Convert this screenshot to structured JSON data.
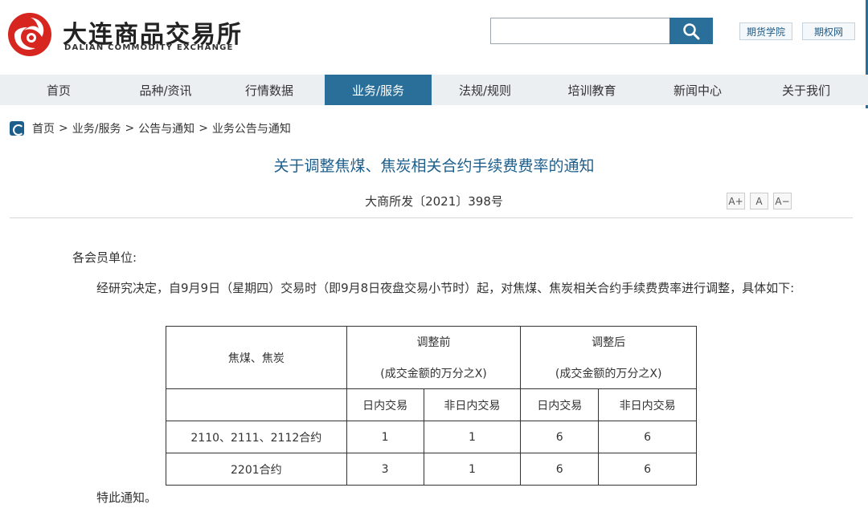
{
  "brand": {
    "name_cn": "大连商品交易所",
    "name_en": "DALIAN COMMODITY EXCHANGE",
    "logo_color": "#d7261f"
  },
  "search": {
    "value": "",
    "placeholder": "",
    "button_icon": "search-icon"
  },
  "top_links": [
    "期货学院",
    "期权网"
  ],
  "nav": {
    "items": [
      "首页",
      "品种/资讯",
      "行情数据",
      "业务/服务",
      "法规/规则",
      "培训教育",
      "新闻中心",
      "关于我们"
    ],
    "active": "业务/服务",
    "accent": "#2a6f9a"
  },
  "breadcrumb": {
    "items": [
      "首页",
      "业务/服务",
      "公告与通知",
      "业务公告与通知"
    ],
    "separator": ">"
  },
  "article": {
    "title": "关于调整焦煤、焦炭相关合约手续费费率的通知",
    "doc_no": "大商所发〔2021〕398号",
    "font_controls": [
      "A+",
      "A",
      "A−"
    ],
    "greeting": "各会员单位:",
    "paragraph": "经研究决定，自9月9日（星期四）交易时（即9月8日夜盘交易小节时）起，对焦煤、焦炭相关合约手续费费率进行调整，具体如下:",
    "closing": "特此通知。"
  },
  "table": {
    "corner": "焦煤、焦炭",
    "group_before": "调整前",
    "group_after": "调整后",
    "unit": "(成交金额的万分之X)",
    "col_intraday": "日内交易",
    "col_non_intraday": "非日内交易",
    "rows": [
      {
        "contract": "2110、2111、2112合约",
        "before_intraday": "1",
        "before_non": "1",
        "after_intraday": "6",
        "after_non": "6"
      },
      {
        "contract": "2201合约",
        "before_intraday": "3",
        "before_non": "1",
        "after_intraday": "6",
        "after_non": "6"
      }
    ]
  }
}
